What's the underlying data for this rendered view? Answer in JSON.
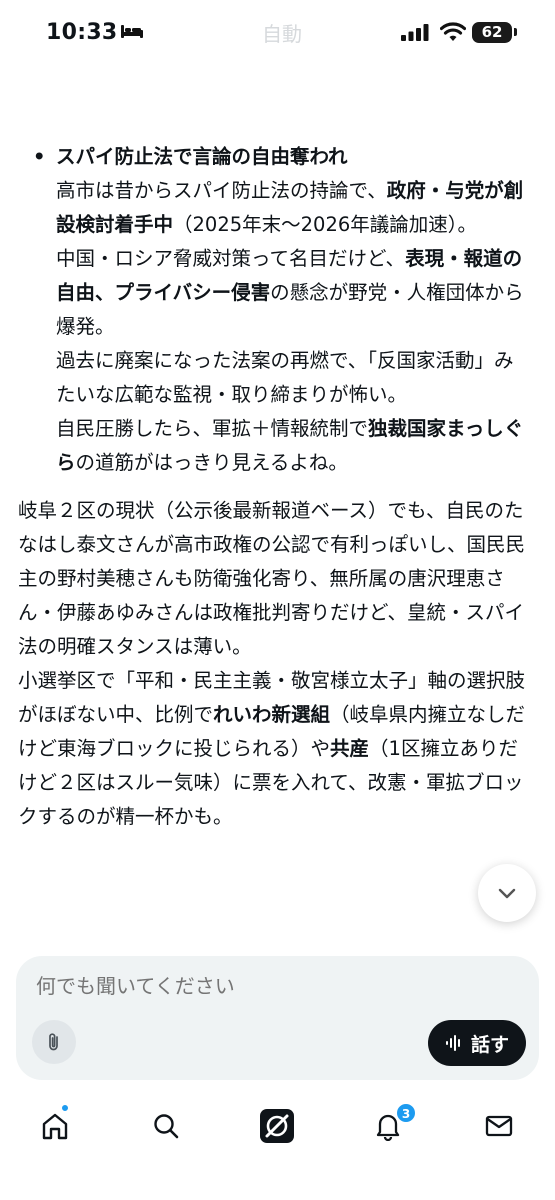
{
  "status_bar": {
    "time": "10:33",
    "mode": "自動",
    "battery": "62",
    "icons": [
      "sleep-icon",
      "signal-icon",
      "wifi-icon",
      "battery-icon"
    ]
  },
  "article": {
    "bullet": {
      "marker": "•",
      "title": "スパイ防止法で言論の自由奪われ",
      "p1": "高市は昔からスパイ防止法の持論で、",
      "p1_bold": "政府・与党が創設検討着手中",
      "p1_tail": "（2025年末〜2026年議論加速）。",
      "p2": "中国・ロシア脅威対策って名目だけど、",
      "p2_bold": "表現・報道の自由、プライバシー侵害",
      "p2_tail": "の懸念が野党・人権団体から爆発。",
      "p3": "過去に廃案になった法案の再燃で、「反国家活動」みたいな広範な監視・取り締まりが怖い。",
      "p4": "自民圧勝したら、軍拡＋情報統制で",
      "p4_bold": "独裁国家まっしぐら",
      "p4_tail": "の道筋がはっきり見えるよね。"
    },
    "para1": "岐阜２区の現状（公示後最新報道ベース）でも、自民のたなはし泰文さんが高市政権の公認で有利っぽいし、国民民主の野村美穂さんも防衛強化寄り、無所属の唐沢理恵さん・伊藤あゆみさんは政権批判寄りだけど、皇統・スパイ法の明確スタンスは薄い。",
    "para2": {
      "a": "小選挙区で「平和・民主主義・敬宮様立太子」軸の選択肢がほぼない中、比例で",
      "b1": "れいわ新選組",
      "c": "（岐阜県内擁立なしだけど東海ブロックに投じられる）や",
      "b2": "共産",
      "d": "（1区擁立ありだけど２区はスルー気味）に票を入れて、改憲・軍拡ブロックするのが精一杯かも。"
    }
  },
  "composer": {
    "placeholder": "何でも聞いてください",
    "attach_icon": "paperclip-icon",
    "speak_label": "話す",
    "speak_icon": "waveform-icon"
  },
  "bottom_nav": {
    "items": [
      "home-icon",
      "search-icon",
      "grok-icon",
      "bell-icon",
      "mail-icon"
    ],
    "notification_count": "3",
    "accent": "#1d9bf0"
  }
}
